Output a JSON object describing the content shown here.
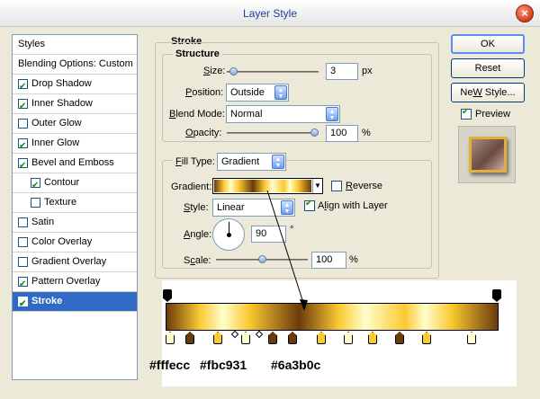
{
  "window": {
    "title": "Layer Style",
    "close_glyph": "×"
  },
  "styles_list": {
    "header": "Styles",
    "items": [
      {
        "label": "Blending Options: Custom",
        "checkbox": false,
        "checked": false,
        "indent": 0
      },
      {
        "label": "Drop Shadow",
        "checkbox": true,
        "checked": true,
        "indent": 0
      },
      {
        "label": "Inner Shadow",
        "checkbox": true,
        "checked": true,
        "indent": 0
      },
      {
        "label": "Outer Glow",
        "checkbox": true,
        "checked": false,
        "indent": 0
      },
      {
        "label": "Inner Glow",
        "checkbox": true,
        "checked": true,
        "indent": 0
      },
      {
        "label": "Bevel and Emboss",
        "checkbox": true,
        "checked": true,
        "indent": 0
      },
      {
        "label": "Contour",
        "checkbox": true,
        "checked": true,
        "indent": 1
      },
      {
        "label": "Texture",
        "checkbox": true,
        "checked": false,
        "indent": 1
      },
      {
        "label": "Satin",
        "checkbox": true,
        "checked": false,
        "indent": 0
      },
      {
        "label": "Color Overlay",
        "checkbox": true,
        "checked": false,
        "indent": 0
      },
      {
        "label": "Gradient Overlay",
        "checkbox": true,
        "checked": false,
        "indent": 0
      },
      {
        "label": "Pattern Overlay",
        "checkbox": true,
        "checked": true,
        "indent": 0
      },
      {
        "label": "Stroke",
        "checkbox": true,
        "checked": true,
        "indent": 0,
        "selected": true
      }
    ]
  },
  "stroke": {
    "title": "Stroke",
    "structure": {
      "title": "Structure",
      "size_label_u": "S",
      "size_label_rest": "ize:",
      "size_value": "3",
      "size_unit": "px",
      "size_slider": 0.03,
      "position_label_u": "P",
      "position_label_rest": "osition:",
      "position_value": "Outside",
      "blend_label_u": "B",
      "blend_label_rest": "lend Mode:",
      "blend_value": "Normal",
      "opacity_label_u": "O",
      "opacity_label_rest": "pacity:",
      "opacity_value": "100",
      "opacity_unit": "%",
      "opacity_slider": 1.0
    },
    "fill": {
      "filltype_label_u": "F",
      "filltype_label_rest": "ill Type:",
      "filltype_value": "Gradient",
      "gradient_label": "Gradient:",
      "reverse_label_u": "R",
      "reverse_label_rest": "everse",
      "reverse_checked": false,
      "style_label_u": "S",
      "style_label_rest": "tyle:",
      "style_value": "Linear",
      "align_label_u": "l",
      "align_label_pre": "A",
      "align_label_rest": "ign with Layer",
      "align_checked": true,
      "angle_label_u": "A",
      "angle_label_rest": "ngle:",
      "angle_value": "90",
      "angle_unit": "°",
      "scale_label_u": "c",
      "scale_label_pre": "S",
      "scale_label_rest": "ale:",
      "scale_value": "100",
      "scale_unit": "%",
      "scale_slider": 0.5
    }
  },
  "buttons": {
    "ok": "OK",
    "reset": "Reset",
    "new_style_u": "W",
    "new_style_pre": "Ne",
    "new_style_rest": " Style...",
    "preview": "Preview",
    "preview_checked": true
  },
  "gradient_colors": {
    "light": "#fffecc",
    "gold": "#fbc931",
    "brown": "#6a3b0c"
  },
  "hex_labels": {
    "first": "#fffecc",
    "second": "#fbc931",
    "third": "#6a3b0c"
  }
}
